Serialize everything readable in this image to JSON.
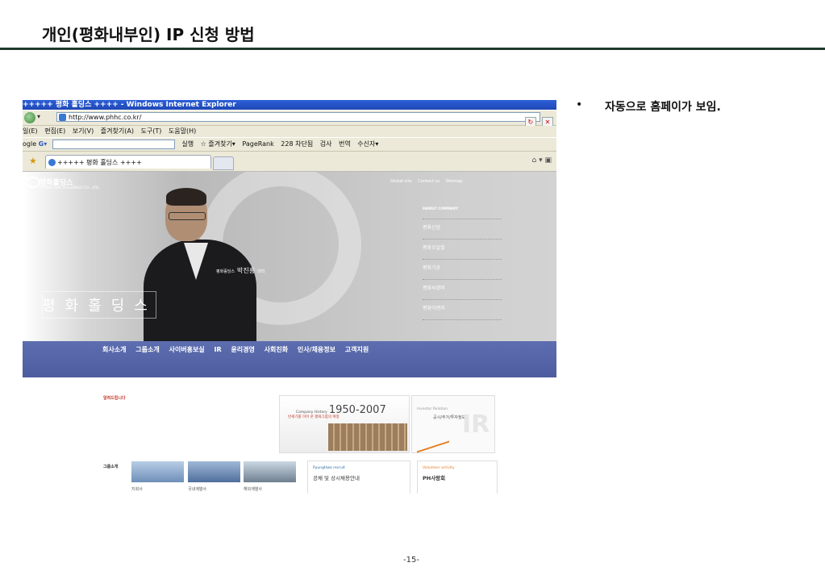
{
  "slide": {
    "title": "개인(평화내부인) IP 신청 방법",
    "bullet_mark": "•",
    "bullet_text": "자동으로 홈페이가 보임.",
    "page_number": "-15-"
  },
  "browser": {
    "window_title": "+++++ 평화 홀딩스 ++++ - Windows Internet Explorer",
    "url": "http://www.phhc.co.kr/",
    "menu": [
      "일(E)",
      "편집(E)",
      "보기(V)",
      "즐겨찾기(A)",
      "도구(T)",
      "도움말(H)"
    ],
    "toolbar": {
      "google_prefix": "ogle",
      "google_button": "G▾",
      "run": "실행",
      "favorites": "즐겨찾기▾",
      "pagerank": "PageRank",
      "blocked": "228 차단됨",
      "check": "검사",
      "translate": "번역",
      "sender": "수신자▾"
    },
    "tab_title": "+++++ 평화 홀딩스 ++++"
  },
  "site": {
    "logo": "평화홀딩스",
    "logo_sub": "PYUNG HWA HOLDINGS CO., LTD.",
    "top_links": [
      "Global site",
      "Contact us",
      "Sitemap"
    ],
    "family_title": "FAMILY COMPANY",
    "family_items": [
      "평화산업",
      "평화오일씰",
      "평화기공",
      "평화씨엠비",
      "평화이엔지"
    ],
    "person_caption": "평화홀딩스",
    "person_name": "박진홍",
    "person_role": "대리",
    "big_title": "평화홀딩스",
    "nav": [
      "회사소개",
      "그룹소개",
      "사이버홍보실",
      "IR",
      "윤리경영",
      "사회친화",
      "인사/채용정보",
      "고객지원"
    ],
    "notice": "알려드립니다",
    "history_label": "Company History",
    "history_years": "1950-2007",
    "history_sub": "반세기를 이어 온 평화그룹의 여정",
    "ir_label": "Investor Relation",
    "ir_sub": "공시/주가/투자정보",
    "ir_big": "IR",
    "group_label": "그룹소개",
    "thumbs": [
      "지회사",
      "국내계열사",
      "해외계열사"
    ],
    "recruit_label": "PyungHwa recruit",
    "recruit_text": "공채 및 상시채용안내",
    "volunteer_label": "Volunteer activity",
    "volunteer_text": "PH사랑회"
  },
  "colors": {
    "title_rule": "#1f3a2a",
    "ie_titlebar": "#2c5fd8",
    "site_nav": "#5d6eb0"
  }
}
